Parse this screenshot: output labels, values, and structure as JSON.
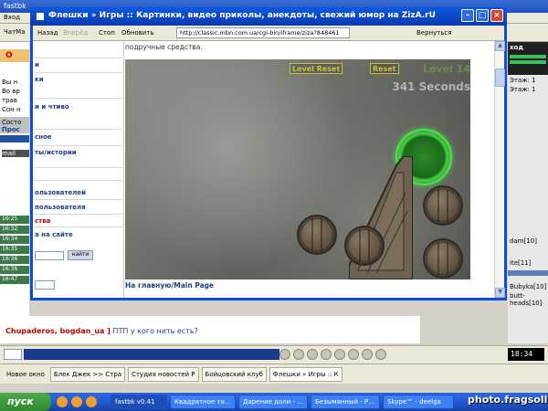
{
  "background_app": {
    "title": "fastbk",
    "menu_label": "Вход",
    "toolbar_label": "ЧатМа",
    "left_snippets": [
      "О",
      "Вы н",
      "Во вр",
      "трав",
      "Сон н",
      "Состо",
      "Прос",
      "mail"
    ],
    "chat_times": [
      "16:25",
      "16:32",
      "16:34",
      "16:35",
      "16:36",
      "16:36",
      "16:47"
    ],
    "chat_line_names": "Chupaderos, bogdan_ua ]",
    "chat_line_message": "ПТП у кого нить есть?",
    "right_panel": {
      "header": "ход",
      "stage1": "Этаж: 1",
      "stage2": "Этаж: 1",
      "users": [
        "dam[10]",
        "ite[11]",
        "Bubyka[10]",
        "butt-heads[10]"
      ]
    },
    "clock": "18:34"
  },
  "inner_tabs": [
    "Новое окно",
    "Блек Джек >> Стра",
    "Студия новостей Р",
    "Бойцовский клуб",
    "Флешки » Игры :: К"
  ],
  "taskbar": {
    "start_label": "пуск",
    "tasks": [
      "fastbk v0.41",
      "Квадратное то...",
      "Дарение доли - ...",
      "Безымянный - Р...",
      "Skype™ - deelga"
    ],
    "watermark": "photo.fragsolls.ru"
  },
  "popup": {
    "title": "Флешки » Игры :: Картинки, видео приколы, анекдоты, свежий юмор на ZizA.rU",
    "nav": {
      "back": "Назад",
      "forward": "Вперёд",
      "stop": "Стоп",
      "refresh": "Обновить",
      "address": "http://classic.mbn.com.ua/cgi-bin/iframe/ziza?848461",
      "return": "Вернуться"
    },
    "side_links": [
      {
        "text": "и",
        "color": "blue"
      },
      {
        "text": "ки",
        "color": "blue"
      },
      {
        "text": "и и чтиво",
        "color": "blue"
      },
      {
        "text": "сное",
        "color": "blue"
      },
      {
        "text": "ты/истории",
        "color": "blue"
      },
      {
        "text": "ользователей",
        "color": "blue"
      },
      {
        "text": "пользователя",
        "color": "blue"
      },
      {
        "text": "ства",
        "color": "red"
      },
      {
        "text": "а на сайте",
        "color": "blue"
      }
    ],
    "side_button": "найти",
    "content_pre_text": "подручные средства.",
    "game": {
      "hud_level_reset": "Level Reset",
      "hud_reset": "Reset",
      "level_label": "Level 14",
      "time_label": "341 Seconds"
    },
    "main_page_link": "На главную/Main Page"
  }
}
